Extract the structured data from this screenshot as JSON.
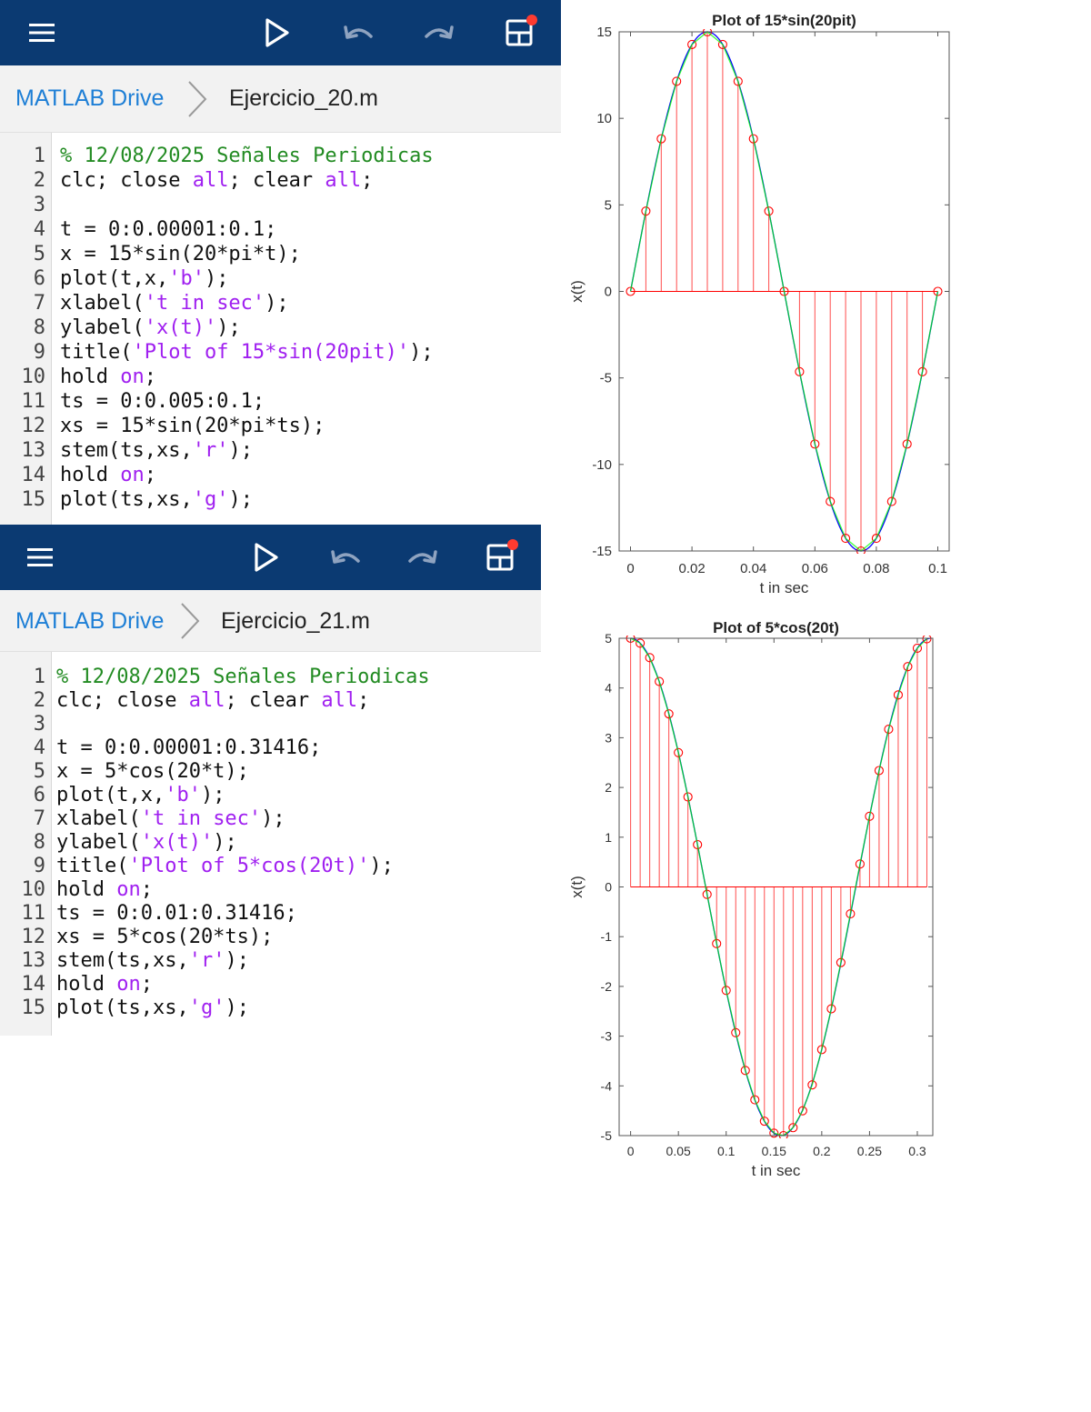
{
  "editors": [
    {
      "breadcrumb": {
        "drive": "MATLAB Drive",
        "file": "Ejercicio_20.m"
      },
      "lines": [
        [
          {
            "t": "% 12/08/2025 Señales Periodicas",
            "c": "comment"
          }
        ],
        [
          {
            "t": "clc; close ",
            "c": "plain"
          },
          {
            "t": "all",
            "c": "kw"
          },
          {
            "t": "; clear ",
            "c": "plain"
          },
          {
            "t": "all",
            "c": "kw"
          },
          {
            "t": ";",
            "c": "plain"
          }
        ],
        [
          {
            "t": "",
            "c": "plain"
          }
        ],
        [
          {
            "t": "t = 0:0.00001:0.1;",
            "c": "plain"
          }
        ],
        [
          {
            "t": "x = 15*sin(20*pi*t);",
            "c": "plain"
          }
        ],
        [
          {
            "t": "plot(t,x,",
            "c": "plain"
          },
          {
            "t": "'b'",
            "c": "str"
          },
          {
            "t": ");",
            "c": "plain"
          }
        ],
        [
          {
            "t": "xlabel(",
            "c": "plain"
          },
          {
            "t": "'t in sec'",
            "c": "str"
          },
          {
            "t": ");",
            "c": "plain"
          }
        ],
        [
          {
            "t": "ylabel(",
            "c": "plain"
          },
          {
            "t": "'x(t)'",
            "c": "str"
          },
          {
            "t": ");",
            "c": "plain"
          }
        ],
        [
          {
            "t": "title(",
            "c": "plain"
          },
          {
            "t": "'Plot of 15*sin(20pit)'",
            "c": "str"
          },
          {
            "t": ");",
            "c": "plain"
          }
        ],
        [
          {
            "t": "hold ",
            "c": "plain"
          },
          {
            "t": "on",
            "c": "kw"
          },
          {
            "t": ";",
            "c": "plain"
          }
        ],
        [
          {
            "t": "ts = 0:0.005:0.1;",
            "c": "plain"
          }
        ],
        [
          {
            "t": "xs = 15*sin(20*pi*ts);",
            "c": "plain"
          }
        ],
        [
          {
            "t": "stem(ts,xs,",
            "c": "plain"
          },
          {
            "t": "'r'",
            "c": "str"
          },
          {
            "t": ");",
            "c": "plain"
          }
        ],
        [
          {
            "t": "hold ",
            "c": "plain"
          },
          {
            "t": "on",
            "c": "kw"
          },
          {
            "t": ";",
            "c": "plain"
          }
        ],
        [
          {
            "t": "plot(ts,xs,",
            "c": "plain"
          },
          {
            "t": "'g'",
            "c": "str"
          },
          {
            "t": ");",
            "c": "plain"
          }
        ]
      ]
    },
    {
      "breadcrumb": {
        "drive": "MATLAB Drive",
        "file": "Ejercicio_21.m"
      },
      "lines": [
        [
          {
            "t": "% 12/08/2025 Señales Periodicas",
            "c": "comment"
          }
        ],
        [
          {
            "t": "clc; close ",
            "c": "plain"
          },
          {
            "t": "all",
            "c": "kw"
          },
          {
            "t": "; clear ",
            "c": "plain"
          },
          {
            "t": "all",
            "c": "kw"
          },
          {
            "t": ";",
            "c": "plain"
          }
        ],
        [
          {
            "t": "",
            "c": "plain"
          }
        ],
        [
          {
            "t": "t = 0:0.00001:0.31416;",
            "c": "plain"
          }
        ],
        [
          {
            "t": "x = 5*cos(20*t);",
            "c": "plain"
          }
        ],
        [
          {
            "t": "plot(t,x,",
            "c": "plain"
          },
          {
            "t": "'b'",
            "c": "str"
          },
          {
            "t": ");",
            "c": "plain"
          }
        ],
        [
          {
            "t": "xlabel(",
            "c": "plain"
          },
          {
            "t": "'t in sec'",
            "c": "str"
          },
          {
            "t": ");",
            "c": "plain"
          }
        ],
        [
          {
            "t": "ylabel(",
            "c": "plain"
          },
          {
            "t": "'x(t)'",
            "c": "str"
          },
          {
            "t": ");",
            "c": "plain"
          }
        ],
        [
          {
            "t": "title(",
            "c": "plain"
          },
          {
            "t": "'Plot of 5*cos(20t)'",
            "c": "str"
          },
          {
            "t": ");",
            "c": "plain"
          }
        ],
        [
          {
            "t": "hold ",
            "c": "plain"
          },
          {
            "t": "on",
            "c": "kw"
          },
          {
            "t": ";",
            "c": "plain"
          }
        ],
        [
          {
            "t": "ts = 0:0.01:0.31416;",
            "c": "plain"
          }
        ],
        [
          {
            "t": "xs = 5*cos(20*ts);",
            "c": "plain"
          }
        ],
        [
          {
            "t": "stem(ts,xs,",
            "c": "plain"
          },
          {
            "t": "'r'",
            "c": "str"
          },
          {
            "t": ");",
            "c": "plain"
          }
        ],
        [
          {
            "t": "hold ",
            "c": "plain"
          },
          {
            "t": "on",
            "c": "kw"
          },
          {
            "t": ";",
            "c": "plain"
          }
        ],
        [
          {
            "t": "plot(ts,xs,",
            "c": "plain"
          },
          {
            "t": "'g'",
            "c": "str"
          },
          {
            "t": ");",
            "c": "plain"
          }
        ]
      ]
    }
  ],
  "toolbar_icons": [
    "hamburger-menu-icon",
    "run-play-icon",
    "undo-icon",
    "redo-icon",
    "layout-grid-icon"
  ],
  "colors": {
    "toolbar_bg": "#0b3a72",
    "notification_dot": "#ff3b30",
    "drive_link": "#1e7fd6",
    "comment": "#228b22",
    "keyword": "#a020f0",
    "string": "#a020f0",
    "plot_blue": "#0000ff",
    "stem_red": "#ff0000",
    "plot_green": "#00ff00"
  },
  "chart_data": [
    {
      "type": "line",
      "title": "Plot of 15*sin(20pit)",
      "xlabel": "t in sec",
      "ylabel": "x(t)",
      "xlim": [
        -0.0037,
        0.1037
      ],
      "ylim": [
        -15,
        15
      ],
      "xticks": [
        0,
        0.02,
        0.04,
        0.06,
        0.08,
        0.1
      ],
      "xtick_labels": [
        "0",
        "0.02",
        "0.04",
        "0.06",
        "0.08",
        "0.1"
      ],
      "yticks": [
        -15,
        -10,
        -5,
        0,
        5,
        10,
        15
      ],
      "ytick_labels": [
        "-15",
        "-10",
        "-5",
        "0",
        "5",
        "10",
        "15"
      ],
      "grid": false,
      "series": [
        {
          "kind": "continuous",
          "color": "blue",
          "x": {
            "start": 0,
            "step": 1e-05,
            "stop": 0.1
          },
          "expr": "15*sin(20*pi*t)"
        },
        {
          "kind": "stem",
          "color": "red",
          "x": [
            0,
            0.005,
            0.01,
            0.015,
            0.02,
            0.025,
            0.03,
            0.035,
            0.04,
            0.045,
            0.05,
            0.055,
            0.06,
            0.065,
            0.07,
            0.075,
            0.08,
            0.085,
            0.09,
            0.095,
            0.1
          ],
          "y": [
            0,
            4.64,
            8.82,
            12.14,
            14.27,
            15,
            14.27,
            12.14,
            8.82,
            4.64,
            0,
            -4.64,
            -8.82,
            -12.14,
            -14.27,
            -15,
            -14.27,
            -12.14,
            -8.82,
            -4.64,
            0
          ]
        },
        {
          "kind": "line",
          "color": "green",
          "x": [
            0,
            0.005,
            0.01,
            0.015,
            0.02,
            0.025,
            0.03,
            0.035,
            0.04,
            0.045,
            0.05,
            0.055,
            0.06,
            0.065,
            0.07,
            0.075,
            0.08,
            0.085,
            0.09,
            0.095,
            0.1
          ],
          "y": [
            0,
            4.64,
            8.82,
            12.14,
            14.27,
            15,
            14.27,
            12.14,
            8.82,
            4.64,
            0,
            -4.64,
            -8.82,
            -12.14,
            -14.27,
            -15,
            -14.27,
            -12.14,
            -8.82,
            -4.64,
            0
          ]
        }
      ]
    },
    {
      "type": "line",
      "title": "Plot of 5*cos(20t)",
      "xlabel": "t in sec",
      "ylabel": "x(t)",
      "xlim": [
        -0.012,
        0.3162
      ],
      "ylim": [
        -5,
        5
      ],
      "xticks": [
        0,
        0.05,
        0.1,
        0.15,
        0.2,
        0.25,
        0.3
      ],
      "xtick_labels": [
        "0",
        "0.05",
        "0.1",
        "0.15",
        "0.2",
        "0.25",
        "0.3"
      ],
      "yticks": [
        -5,
        -4,
        -3,
        -2,
        -1,
        0,
        1,
        2,
        3,
        4,
        5
      ],
      "ytick_labels": [
        "-5",
        "-4",
        "-3",
        "-2",
        "-1",
        "0",
        "1",
        "2",
        "3",
        "4",
        "5"
      ],
      "grid": false,
      "series": [
        {
          "kind": "continuous",
          "color": "blue",
          "x": {
            "start": 0,
            "step": 1e-05,
            "stop": 0.31416
          },
          "expr": "5*cos(20*t)"
        },
        {
          "kind": "stem",
          "color": "red",
          "x": [
            0,
            0.01,
            0.02,
            0.03,
            0.04,
            0.05,
            0.06,
            0.07,
            0.08,
            0.09,
            0.1,
            0.11,
            0.12,
            0.13,
            0.14,
            0.15,
            0.16,
            0.17,
            0.18,
            0.19,
            0.2,
            0.21,
            0.22,
            0.23,
            0.24,
            0.25,
            0.26,
            0.27,
            0.28,
            0.29,
            0.3,
            0.31
          ],
          "y": [
            5,
            4.9,
            4.61,
            4.13,
            3.48,
            2.7,
            1.81,
            0.85,
            -0.15,
            -1.14,
            -2.08,
            -2.93,
            -3.69,
            -4.28,
            -4.71,
            -4.95,
            -5,
            -4.84,
            -4.5,
            -3.98,
            -3.27,
            -2.45,
            -1.52,
            -0.54,
            0.46,
            1.42,
            2.34,
            3.17,
            3.86,
            4.43,
            4.8,
            4.99
          ]
        },
        {
          "kind": "line",
          "color": "green",
          "x": [
            0,
            0.01,
            0.02,
            0.03,
            0.04,
            0.05,
            0.06,
            0.07,
            0.08,
            0.09,
            0.1,
            0.11,
            0.12,
            0.13,
            0.14,
            0.15,
            0.16,
            0.17,
            0.18,
            0.19,
            0.2,
            0.21,
            0.22,
            0.23,
            0.24,
            0.25,
            0.26,
            0.27,
            0.28,
            0.29,
            0.3,
            0.31
          ],
          "y": [
            5,
            4.9,
            4.61,
            4.13,
            3.48,
            2.7,
            1.81,
            0.85,
            -0.15,
            -1.14,
            -2.08,
            -2.93,
            -3.69,
            -4.28,
            -4.71,
            -4.95,
            -5,
            -4.84,
            -4.5,
            -3.98,
            -3.27,
            -2.45,
            -1.52,
            -0.54,
            0.46,
            1.42,
            2.34,
            3.17,
            3.86,
            4.43,
            4.8,
            4.99
          ]
        }
      ]
    }
  ]
}
